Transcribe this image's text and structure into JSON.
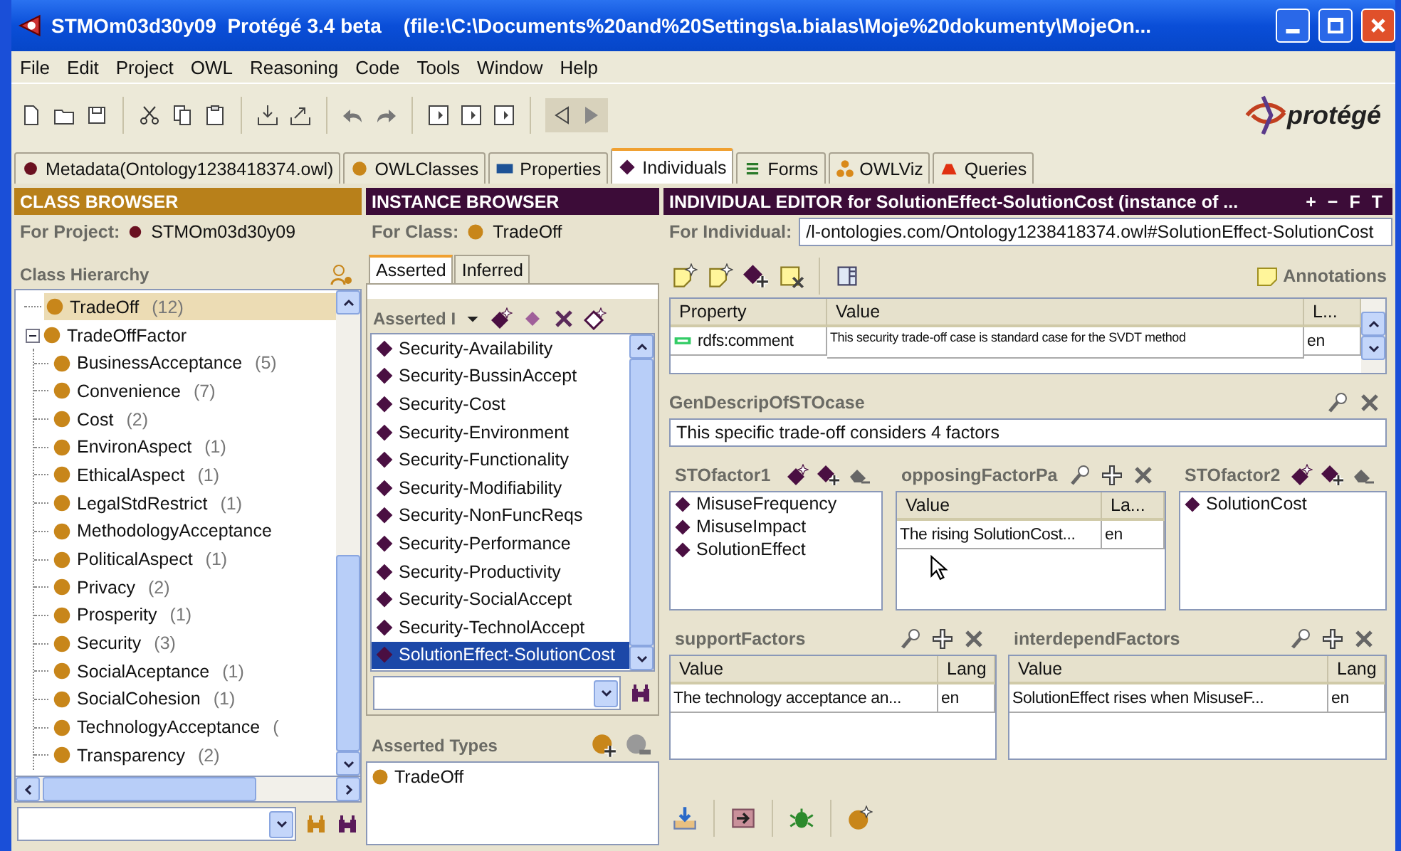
{
  "window": {
    "title": "STMOm03d30y09  Protégé 3.4 beta    (file:\\C:\\Documents%20and%20Settings\\a.bialas\\Moje%20dokumenty\\MojeOn..."
  },
  "menu": [
    "File",
    "Edit",
    "Project",
    "OWL",
    "Reasoning",
    "Code",
    "Tools",
    "Window",
    "Help"
  ],
  "logo": "protégé",
  "tabs": [
    {
      "label": "Metadata(Ontology1238418374.owl)",
      "kind": "ontology",
      "selected": false
    },
    {
      "label": "OWLClasses",
      "kind": "class",
      "selected": false
    },
    {
      "label": "Properties",
      "kind": "property",
      "selected": false
    },
    {
      "label": "Individuals",
      "kind": "individual",
      "selected": true
    },
    {
      "label": "Forms",
      "kind": "form",
      "selected": false
    },
    {
      "label": "OWLViz",
      "kind": "graph",
      "selected": false
    },
    {
      "label": "Queries",
      "kind": "query",
      "selected": false
    }
  ],
  "class_browser": {
    "title": "CLASS BROWSER",
    "project_label": "For Project:",
    "project": "STMOm03d30y09",
    "hierarchy_label": "Class Hierarchy",
    "tree": [
      {
        "name": "TradeOff",
        "count": "(12)",
        "selected": true
      },
      {
        "name": "TradeOffFactor",
        "selected": false,
        "expanded": true,
        "children": [
          {
            "name": "BusinessAcceptance",
            "count": "(5)",
            "selected": false
          },
          {
            "name": "Convenience",
            "count": "(7)",
            "selected": false
          },
          {
            "name": "Cost",
            "count": "(2)",
            "selected": false
          },
          {
            "name": "EnvironAspect",
            "count": "(1)",
            "selected": false
          },
          {
            "name": "EthicalAspect",
            "count": "(1)",
            "selected": false
          },
          {
            "name": "LegalStdRestrict",
            "count": "(1)",
            "selected": false
          },
          {
            "name": "MethodologyAcceptance",
            "selected": false
          },
          {
            "name": "PoliticalAspect",
            "count": "(1)",
            "selected": false
          },
          {
            "name": "Privacy",
            "count": "(2)",
            "selected": false
          },
          {
            "name": "Prosperity",
            "count": "(1)",
            "selected": false
          },
          {
            "name": "Security",
            "count": "(3)",
            "selected": false
          },
          {
            "name": "SocialAceptance",
            "count": "(1)",
            "selected": false
          },
          {
            "name": "SocialCohesion",
            "count": "(1)",
            "selected": false
          },
          {
            "name": "TechnologyAcceptance",
            "count": "(",
            "selected": false
          },
          {
            "name": "Transparency",
            "count": "(2)",
            "selected": false
          }
        ]
      }
    ]
  },
  "instance_browser": {
    "title": "INSTANCE BROWSER",
    "class_label": "For Class:",
    "class": "TradeOff",
    "subtabs": [
      {
        "label": "Asserted",
        "selected": true
      },
      {
        "label": "Inferred",
        "selected": false
      }
    ],
    "list_label": "Asserted I",
    "instances": [
      {
        "name": "Security-Availability",
        "selected": false
      },
      {
        "name": "Security-BussinAccept",
        "selected": false
      },
      {
        "name": "Security-Cost",
        "selected": false
      },
      {
        "name": "Security-Environment",
        "selected": false
      },
      {
        "name": "Security-Functionality",
        "selected": false
      },
      {
        "name": "Security-Modifiability",
        "selected": false
      },
      {
        "name": "Security-NonFuncReqs",
        "selected": false
      },
      {
        "name": "Security-Performance",
        "selected": false
      },
      {
        "name": "Security-Productivity",
        "selected": false
      },
      {
        "name": "Security-SocialAccept",
        "selected": false
      },
      {
        "name": "Security-TechnolAccept",
        "selected": false
      },
      {
        "name": "SolutionEffect-SolutionCost",
        "selected": true
      }
    ],
    "types_label": "Asserted Types",
    "types": [
      "TradeOff"
    ]
  },
  "editor": {
    "title": "INDIVIDUAL EDITOR for SolutionEffect-SolutionCost   (instance of ...",
    "title_buttons": [
      "+",
      "−",
      "F",
      "T"
    ],
    "individual_label": "For Individual:",
    "individual": "/l-ontologies.com/Ontology1238418374.owl#SolutionEffect-SolutionCost",
    "annotations_label": "Annotations",
    "annotations": {
      "columns": [
        "Property",
        "Value",
        "L..."
      ],
      "rows": [
        [
          "rdfs:comment",
          "This security trade-off case is standard case for the SVDT method",
          "en"
        ]
      ]
    },
    "description": {
      "label": "GenDescripOfSTOcase",
      "value": "This specific trade-off considers 4 factors"
    },
    "factor1": {
      "label": "STOfactor1",
      "items": [
        "MisuseFrequency",
        "MisuseImpact",
        "SolutionEffect"
      ]
    },
    "opposing": {
      "label": "opposingFactorPa",
      "columns": [
        "Value",
        "La..."
      ],
      "rows": [
        [
          "The rising SolutionCost...",
          "en"
        ]
      ]
    },
    "factor2": {
      "label": "STOfactor2",
      "items": [
        "SolutionCost"
      ]
    },
    "support": {
      "label": "supportFactors",
      "columns": [
        "Value",
        "Lang"
      ],
      "rows": [
        [
          "The technology acceptance an...",
          "en"
        ]
      ]
    },
    "interdepend": {
      "label": "interdependFactors",
      "columns": [
        "Value",
        "Lang"
      ],
      "rows": [
        [
          "SolutionEffect rises when MisuseF...",
          "en"
        ]
      ]
    }
  }
}
